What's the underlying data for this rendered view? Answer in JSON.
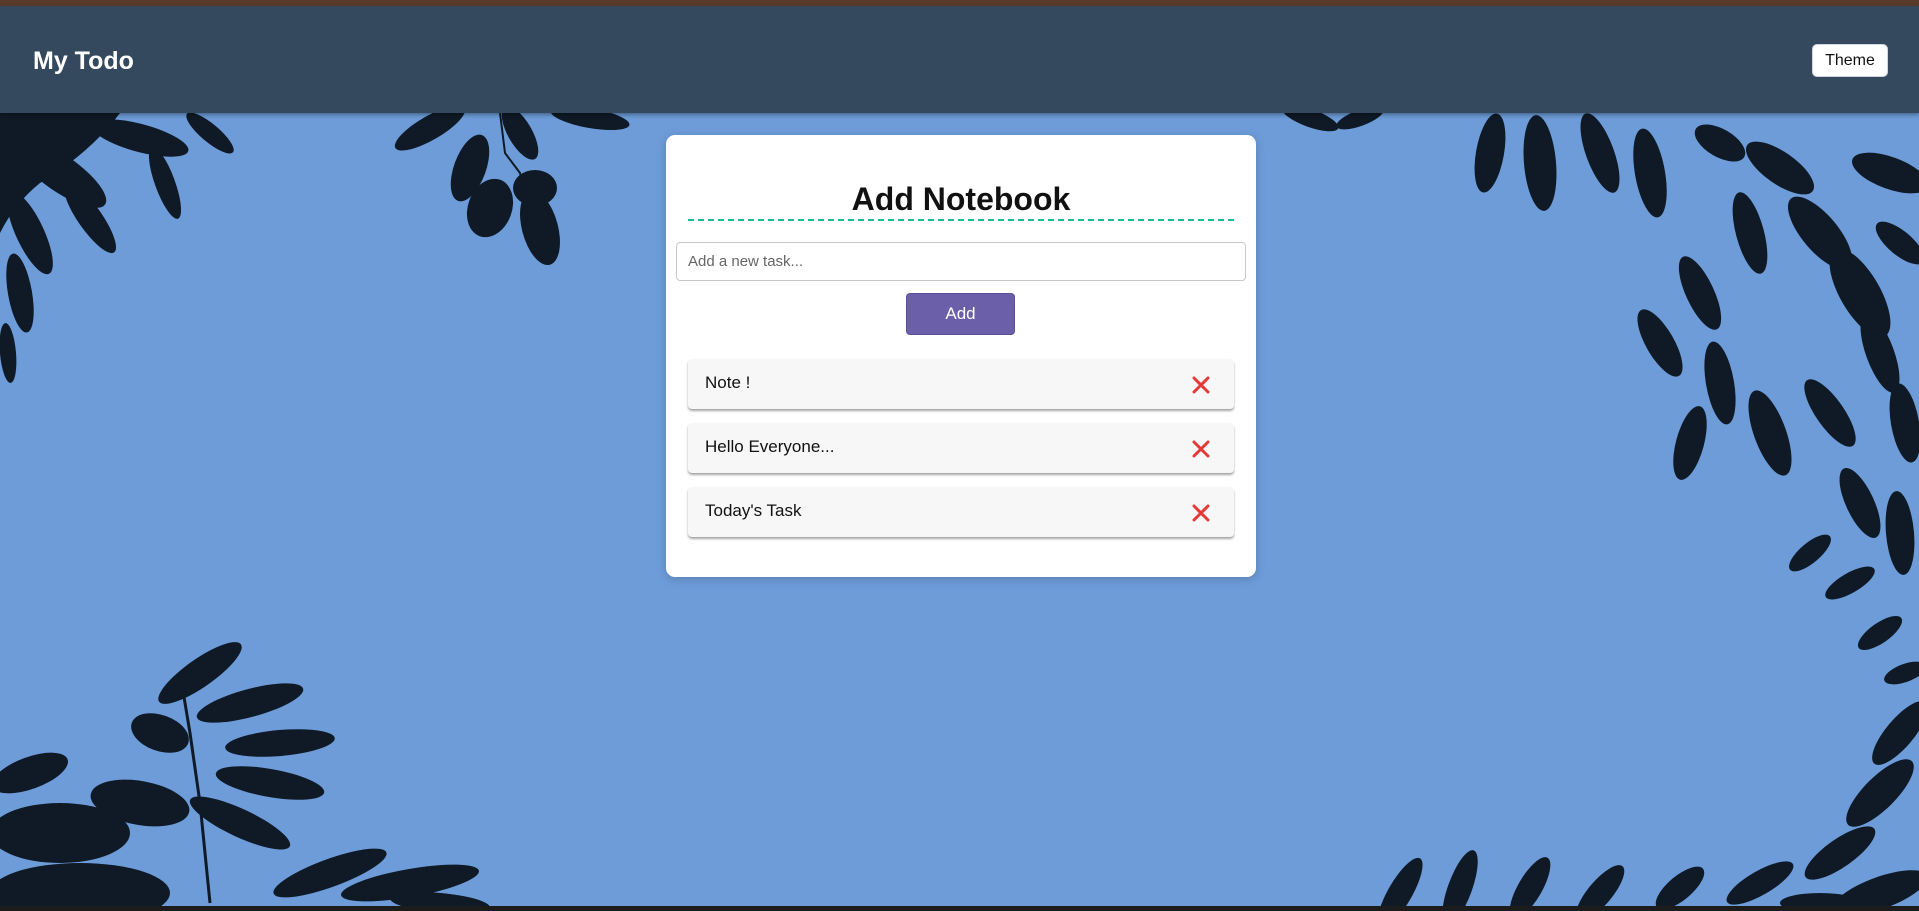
{
  "navbar": {
    "brand": "My Todo",
    "theme_button_label": "Theme"
  },
  "card": {
    "title": "Add Notebook",
    "input": {
      "placeholder": "Add a new task...",
      "value": ""
    },
    "add_button_label": "Add",
    "tasks": [
      {
        "text": "Note !"
      },
      {
        "text": "Hello Everyone..."
      },
      {
        "text": "Today's Task"
      }
    ]
  },
  "icons": {
    "delete": "close-icon"
  },
  "colors": {
    "navbar_bg": "#34495e",
    "page_bg": "#6d9cd9",
    "title_rule": "#1abc9c",
    "add_button": "#6a5fa8",
    "delete_icon": "#e53935"
  }
}
